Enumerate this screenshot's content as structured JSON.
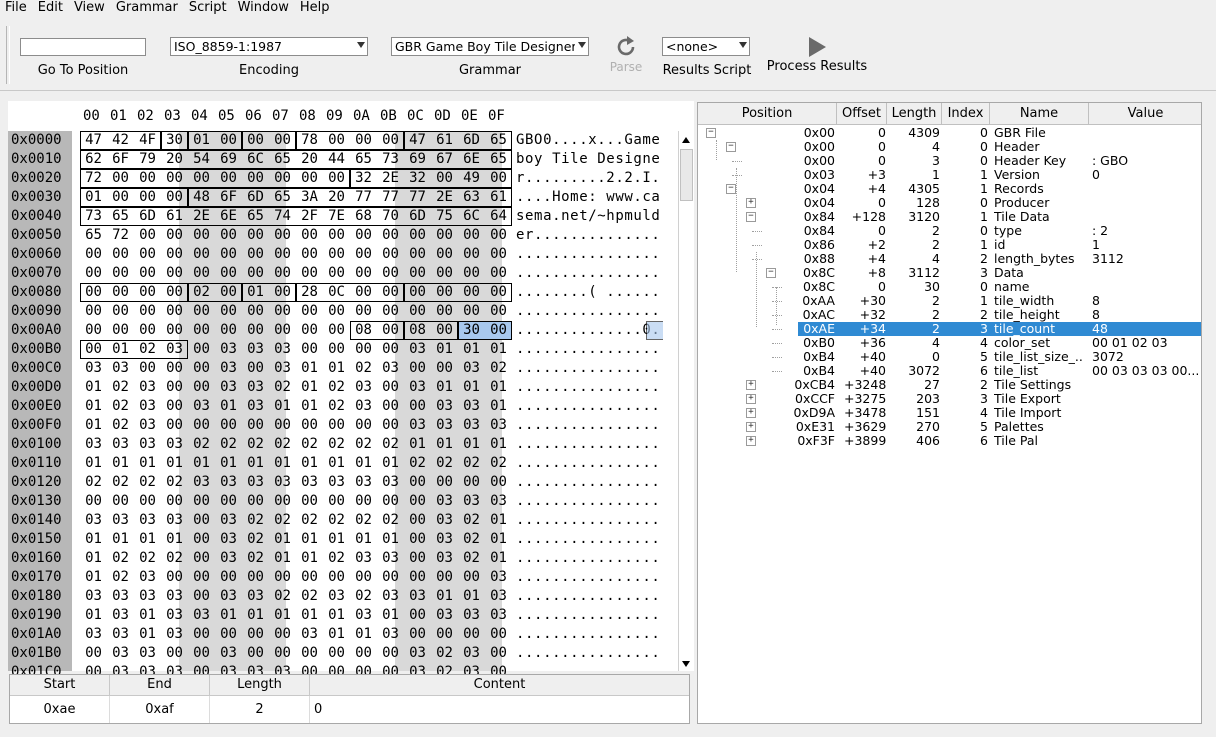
{
  "menu": [
    "File",
    "Edit",
    "View",
    "Grammar",
    "Script",
    "Window",
    "Help"
  ],
  "toolbar": {
    "goto_value": "",
    "goto_label": "Go To Position",
    "encoding_value": "ISO_8859-1:1987",
    "encoding_label": "Encoding",
    "grammar_value": "GBR Game Boy Tile Designer",
    "grammar_label": "Grammar",
    "parse_label": "Parse",
    "results_script_value": "<none>",
    "results_script_label": "Results Script",
    "process_label": "Process Results"
  },
  "hex": {
    "columns": [
      "00",
      "01",
      "02",
      "03",
      "04",
      "05",
      "06",
      "07",
      "08",
      "09",
      "0A",
      "0B",
      "0C",
      "0D",
      "0E",
      "0F"
    ],
    "rows": [
      {
        "addr": "0x0000",
        "bytes": "47 42 4F 30 01 00 00 00 78 00 00 00 47 61 6D 65",
        "ascii": "GBO0....x...Game"
      },
      {
        "addr": "0x0010",
        "bytes": "62 6F 79 20 54 69 6C 65 20 44 65 73 69 67 6E 65",
        "ascii": "boy Tile Designe"
      },
      {
        "addr": "0x0020",
        "bytes": "72 00 00 00 00 00 00 00 00 00 32 2E 32 00 49 00",
        "ascii": "r.........2.2.I."
      },
      {
        "addr": "0x0030",
        "bytes": "01 00 00 00 48 6F 6D 65 3A 20 77 77 77 2E 63 61",
        "ascii": "....Home: www.ca"
      },
      {
        "addr": "0x0040",
        "bytes": "73 65 6D 61 2E 6E 65 74 2F 7E 68 70 6D 75 6C 64",
        "ascii": "sema.net/~hpmuld"
      },
      {
        "addr": "0x0050",
        "bytes": "65 72 00 00 00 00 00 00 00 00 00 00 00 00 00 00",
        "ascii": "er.............."
      },
      {
        "addr": "0x0060",
        "bytes": "00 00 00 00 00 00 00 00 00 00 00 00 00 00 00 00",
        "ascii": "................"
      },
      {
        "addr": "0x0070",
        "bytes": "00 00 00 00 00 00 00 00 00 00 00 00 00 00 00 00",
        "ascii": "................"
      },
      {
        "addr": "0x0080",
        "bytes": "00 00 00 00 02 00 01 00 28 0C 00 00 00 00 00 00",
        "ascii": "........( ......"
      },
      {
        "addr": "0x0090",
        "bytes": "00 00 00 00 00 00 00 00 00 00 00 00 00 00 00 00",
        "ascii": "................"
      },
      {
        "addr": "0x00A0",
        "bytes": "00 00 00 00 00 00 00 00 00 00 08 00 08 00 30 00",
        "ascii": "..............0."
      },
      {
        "addr": "0x00B0",
        "bytes": "00 01 02 03 00 03 03 03 00 00 00 00 03 01 01 01",
        "ascii": "................"
      },
      {
        "addr": "0x00C0",
        "bytes": "03 03 00 00 00 03 00 03 01 01 02 03 00 00 03 02",
        "ascii": "................"
      },
      {
        "addr": "0x00D0",
        "bytes": "01 02 03 00 00 03 03 02 01 02 03 00 03 01 01 01",
        "ascii": "................"
      },
      {
        "addr": "0x00E0",
        "bytes": "01 02 03 00 03 01 03 01 01 02 03 00 00 03 03 01",
        "ascii": "................"
      },
      {
        "addr": "0x00F0",
        "bytes": "01 02 03 00 00 00 00 00 00 00 00 00 03 03 03 03",
        "ascii": "................"
      },
      {
        "addr": "0x0100",
        "bytes": "03 03 03 03 02 02 02 02 02 02 02 02 01 01 01 01",
        "ascii": "................"
      },
      {
        "addr": "0x0110",
        "bytes": "01 01 01 01 01 01 01 01 01 01 01 01 02 02 02 02",
        "ascii": "................"
      },
      {
        "addr": "0x0120",
        "bytes": "02 02 02 02 03 03 03 03 03 03 03 03 00 00 00 00",
        "ascii": "................"
      },
      {
        "addr": "0x0130",
        "bytes": "00 00 00 00 00 00 00 00 00 00 00 00 00 03 03 03",
        "ascii": "................"
      },
      {
        "addr": "0x0140",
        "bytes": "03 03 03 03 00 03 02 02 02 02 02 02 00 03 02 01",
        "ascii": "................"
      },
      {
        "addr": "0x0150",
        "bytes": "01 01 01 01 00 03 02 01 01 01 01 01 00 03 02 01",
        "ascii": "................"
      },
      {
        "addr": "0x0160",
        "bytes": "01 02 02 02 00 03 02 01 01 02 03 03 00 03 02 01",
        "ascii": "................"
      },
      {
        "addr": "0x0170",
        "bytes": "01 02 03 00 00 00 00 00 00 00 00 00 00 00 00 03",
        "ascii": "................"
      },
      {
        "addr": "0x0180",
        "bytes": "03 03 03 03 00 03 03 02 02 03 02 03 03 01 01 03",
        "ascii": "................"
      },
      {
        "addr": "0x0190",
        "bytes": "01 03 01 03 03 01 01 01 01 01 03 01 00 03 03 03",
        "ascii": "................"
      },
      {
        "addr": "0x01A0",
        "bytes": "03 03 01 03 00 00 00 00 03 01 01 03 00 00 00 00",
        "ascii": "................"
      },
      {
        "addr": "0x01B0",
        "bytes": "00 03 03 00 00 03 00 00 00 00 00 00 03 02 03 00",
        "ascii": "................"
      },
      {
        "addr": "0x01C0",
        "bytes": "00 03 03 03 00 03 03 03 00 00 00 00 03 02 03 00",
        "ascii": "................"
      }
    ]
  },
  "selection": {
    "headers": [
      "Start",
      "End",
      "Length",
      "Content"
    ],
    "start": "0xae",
    "end": "0xaf",
    "length": "2",
    "content": "0"
  },
  "tree": {
    "headers": [
      "Position",
      "Offset",
      "Length",
      "Index",
      "Name",
      "Value"
    ],
    "rows": [
      {
        "pos": "0x00",
        "off": "0",
        "len": "4309",
        "idx": "0",
        "name": "GBR File",
        "val": "",
        "depth": 0,
        "exp": "-"
      },
      {
        "pos": "0x00",
        "off": "0",
        "len": "4",
        "idx": "0",
        "name": "Header",
        "val": "",
        "depth": 1,
        "exp": "-"
      },
      {
        "pos": "0x00",
        "off": "0",
        "len": "3",
        "idx": "0",
        "name": "Header Key",
        "val": ": GBO",
        "depth": 2,
        "exp": ""
      },
      {
        "pos": "0x03",
        "off": "+3",
        "len": "1",
        "idx": "1",
        "name": "Version",
        "val": "0",
        "depth": 2,
        "exp": ""
      },
      {
        "pos": "0x04",
        "off": "+4",
        "len": "4305",
        "idx": "1",
        "name": "Records",
        "val": "",
        "depth": 1,
        "exp": "-"
      },
      {
        "pos": "0x04",
        "off": "0",
        "len": "128",
        "idx": "0",
        "name": "Producer",
        "val": "",
        "depth": 2,
        "exp": "+"
      },
      {
        "pos": "0x84",
        "off": "+128",
        "len": "3120",
        "idx": "1",
        "name": "Tile Data",
        "val": "",
        "depth": 2,
        "exp": "-"
      },
      {
        "pos": "0x84",
        "off": "0",
        "len": "2",
        "idx": "0",
        "name": "type",
        "val": ": 2",
        "depth": 3,
        "exp": ""
      },
      {
        "pos": "0x86",
        "off": "+2",
        "len": "2",
        "idx": "1",
        "name": "id",
        "val": "1",
        "depth": 3,
        "exp": ""
      },
      {
        "pos": "0x88",
        "off": "+4",
        "len": "4",
        "idx": "2",
        "name": "length_bytes",
        "val": "3112",
        "depth": 3,
        "exp": ""
      },
      {
        "pos": "0x8C",
        "off": "+8",
        "len": "3112",
        "idx": "3",
        "name": "Data",
        "val": "",
        "depth": 3,
        "exp": "-"
      },
      {
        "pos": "0x8C",
        "off": "0",
        "len": "30",
        "idx": "0",
        "name": "name",
        "val": "",
        "depth": 4,
        "exp": ""
      },
      {
        "pos": "0xAA",
        "off": "+30",
        "len": "2",
        "idx": "1",
        "name": "tile_width",
        "val": "8",
        "depth": 4,
        "exp": ""
      },
      {
        "pos": "0xAC",
        "off": "+32",
        "len": "2",
        "idx": "2",
        "name": "tile_height",
        "val": "8",
        "depth": 4,
        "exp": ""
      },
      {
        "pos": "0xAE",
        "off": "+34",
        "len": "2",
        "idx": "3",
        "name": "tile_count",
        "val": "48",
        "depth": 4,
        "exp": "",
        "selected": true
      },
      {
        "pos": "0xB0",
        "off": "+36",
        "len": "4",
        "idx": "4",
        "name": "color_set",
        "val": "00 01 02 03",
        "depth": 4,
        "exp": ""
      },
      {
        "pos": "0xB4",
        "off": "+40",
        "len": "0",
        "idx": "5",
        "name": "tile_list_size_...",
        "val": "3072",
        "depth": 4,
        "exp": ""
      },
      {
        "pos": "0xB4",
        "off": "+40",
        "len": "3072",
        "idx": "6",
        "name": "tile_list",
        "val": "00 03 03 03 00...",
        "depth": 4,
        "exp": ""
      },
      {
        "pos": "0xCB4",
        "off": "+3248",
        "len": "27",
        "idx": "2",
        "name": "Tile Settings",
        "val": "",
        "depth": 2,
        "exp": "+"
      },
      {
        "pos": "0xCCF",
        "off": "+3275",
        "len": "203",
        "idx": "3",
        "name": "Tile Export",
        "val": "",
        "depth": 2,
        "exp": "+"
      },
      {
        "pos": "0xD9A",
        "off": "+3478",
        "len": "151",
        "idx": "4",
        "name": "Tile Import",
        "val": "",
        "depth": 2,
        "exp": "+"
      },
      {
        "pos": "0xE31",
        "off": "+3629",
        "len": "270",
        "idx": "5",
        "name": "Palettes",
        "val": "",
        "depth": 2,
        "exp": "+"
      },
      {
        "pos": "0xF3F",
        "off": "+3899",
        "len": "406",
        "idx": "6",
        "name": "Tile Pal",
        "val": "",
        "depth": 2,
        "exp": "+"
      }
    ]
  }
}
